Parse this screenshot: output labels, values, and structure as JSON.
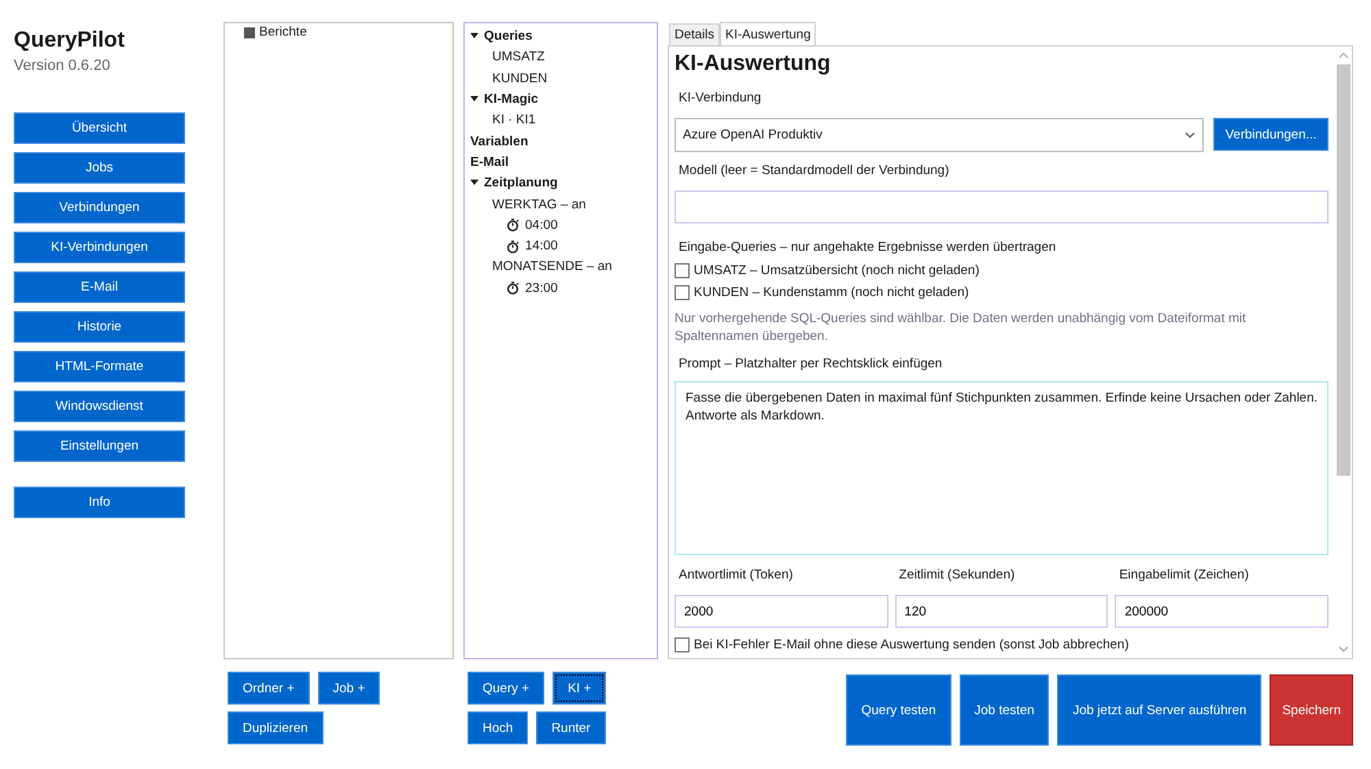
{
  "app": {
    "title": "QueryPilot",
    "version": "Version 0.6.20"
  },
  "nav": [
    {
      "label": "Übersicht"
    },
    {
      "label": "Jobs"
    },
    {
      "label": "Verbindungen"
    },
    {
      "label": "KI-Verbindungen"
    },
    {
      "label": "E-Mail"
    },
    {
      "label": "Historie"
    },
    {
      "label": "HTML-Formate"
    },
    {
      "label": "Windowsdienst"
    },
    {
      "label": "Einstellungen"
    }
  ],
  "info_button": "Info",
  "folders": [
    {
      "label": "Berichte"
    }
  ],
  "job_tree": [
    {
      "label": "Queries",
      "kind": "group",
      "expanded": true,
      "children": [
        {
          "label": "UMSATZ",
          "kind": "item"
        },
        {
          "label": "KUNDEN",
          "kind": "item"
        }
      ]
    },
    {
      "label": "KI-Magic",
      "kind": "group",
      "expanded": true,
      "children": [
        {
          "label": "KI · KI1",
          "kind": "item"
        }
      ]
    },
    {
      "label": "Variablen",
      "kind": "group"
    },
    {
      "label": "E-Mail",
      "kind": "group"
    },
    {
      "label": "Zeitplanung",
      "kind": "group",
      "expanded": true,
      "children": [
        {
          "label": "WERKTAG – an",
          "kind": "item",
          "children": [
            {
              "label": "04:00",
              "kind": "schedule"
            },
            {
              "label": "14:00",
              "kind": "schedule"
            }
          ]
        },
        {
          "label": "MONATSENDE – an",
          "kind": "item",
          "children": [
            {
              "label": "23:00",
              "kind": "schedule"
            }
          ]
        }
      ]
    }
  ],
  "tabs": [
    {
      "label": "Details",
      "selected": false
    },
    {
      "label": "KI-Auswertung",
      "selected": true
    }
  ],
  "form": {
    "heading": "KI-Auswertung",
    "connection_label": "KI-Verbindung",
    "connection_value": "Azure OpenAI Produktiv",
    "connections_button": "Verbindungen...",
    "model_label": "Modell (leer = Standardmodell der Verbindung)",
    "inputs_label": "Eingabe-Queries – nur angehakte Ergebnisse werden übertragen",
    "inputs": [
      {
        "label": "UMSATZ – Umsatzübersicht (noch nicht geladen)",
        "checked": false
      },
      {
        "label": "KUNDEN – Kundenstamm (noch nicht geladen)",
        "checked": false
      }
    ],
    "hint": "Nur vorhergehende SQL-Queries sind wählbar. Die Daten werden unabhängig vom Dateiformat mit Spaltennamen übergeben.",
    "prompt_label": "Prompt – Platzhalter per Rechtsklick einfügen",
    "prompt": "Fasse die übergebenen Daten in maximal fünf Stichpunkten zusammen. Erfinde keine Ursachen oder Zahlen. Antworte als Markdown.",
    "limits": [
      {
        "label": "Antwortlimit (Token)",
        "value": "2000"
      },
      {
        "label": "Zeitlimit (Sekunden)",
        "value": "120"
      },
      {
        "label": "Eingabelimit (Zeichen)",
        "value": "200000"
      }
    ],
    "fallback": {
      "label": "Bei KI-Fehler E-Mail ohne diese Auswertung senden (sonst Job abbrechen)",
      "checked": false
    }
  },
  "folder_buttons": [
    [
      "Ordner +",
      "Job +"
    ],
    [
      "Duplizieren"
    ]
  ],
  "tree_buttons": [
    [
      {
        "label": "Query +",
        "focused": false
      },
      {
        "label": "KI +",
        "focused": true
      }
    ],
    [
      {
        "label": "Hoch",
        "focused": false
      },
      {
        "label": "Runter",
        "focused": false
      }
    ]
  ],
  "actions": [
    {
      "label": "Query testen",
      "kind": "primary"
    },
    {
      "label": "Job testen",
      "kind": "primary"
    },
    {
      "label": "Job jetzt auf Server ausführen",
      "kind": "primary"
    },
    {
      "label": "Speichern",
      "kind": "danger"
    }
  ]
}
